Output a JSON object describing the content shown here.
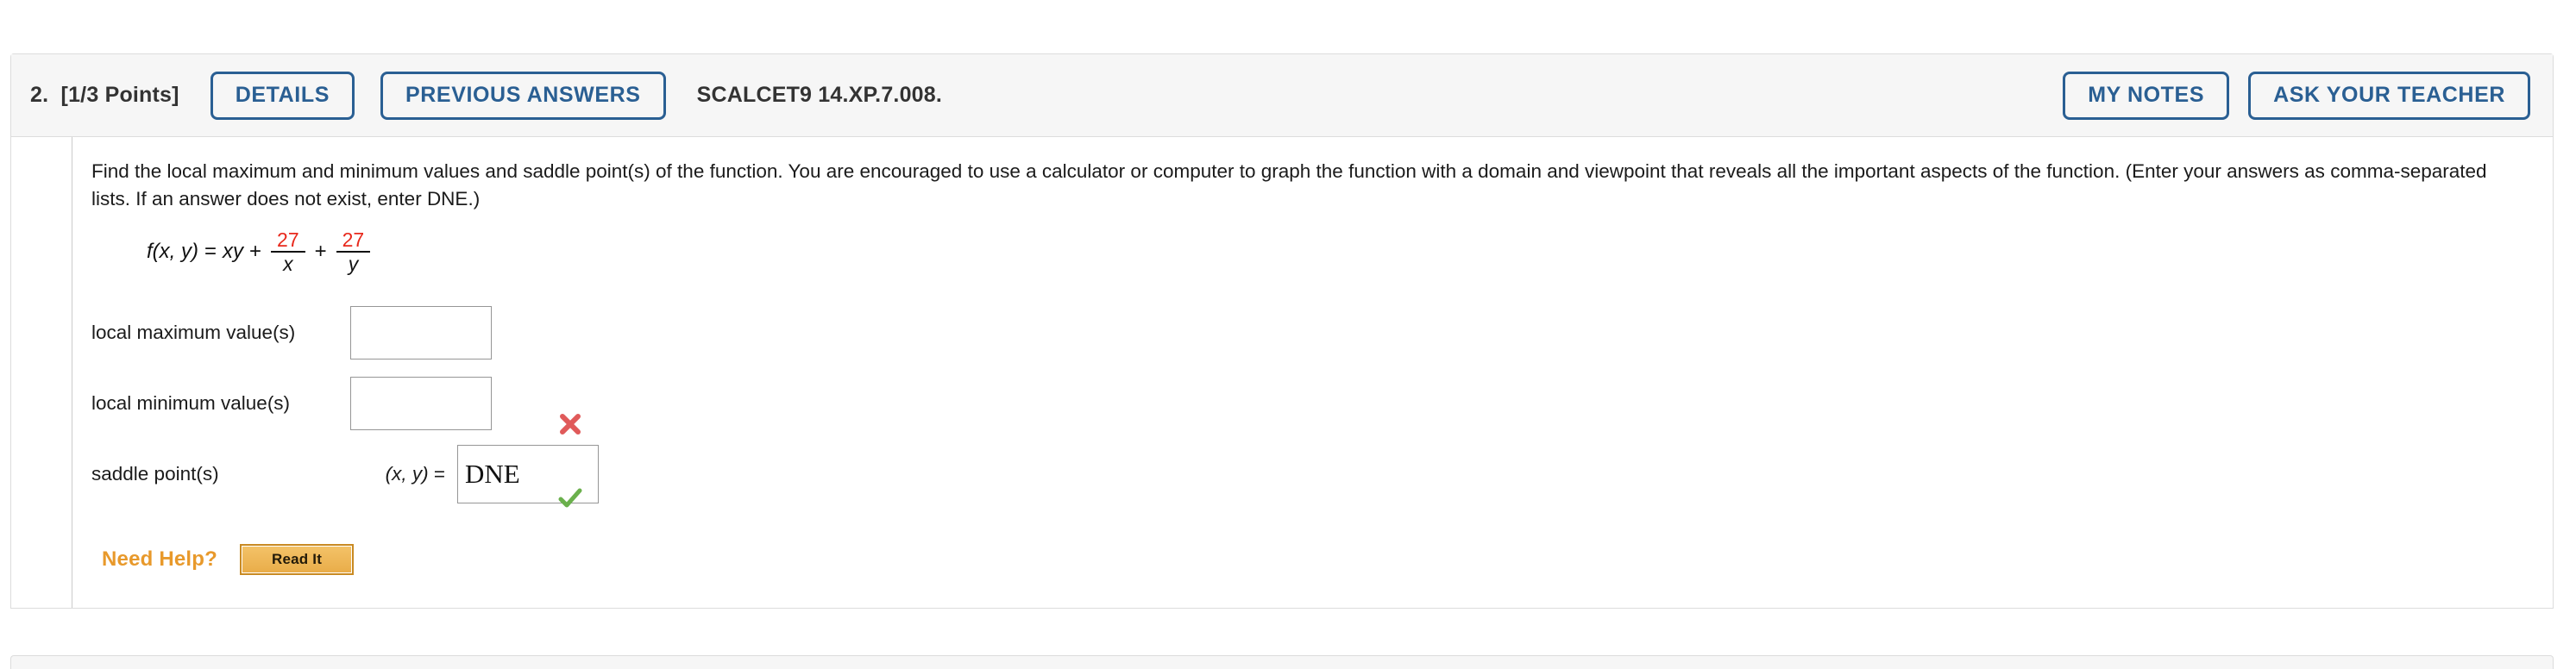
{
  "question": {
    "number_points": "2.  [1/3 Points]",
    "details_label": "DETAILS",
    "previous_answers_label": "PREVIOUS ANSWERS",
    "assignment_code": "SCALCET9 14.XP.7.008.",
    "my_notes_label": "MY NOTES",
    "ask_your_teacher_label": "ASK YOUR TEACHER"
  },
  "prompt": {
    "line1": "Find the local maximum and minimum values and saddle point(s) of the function. You are encouraged to use a calculator or computer to graph the function with a domain and viewpoint that reveals all the important aspects of the function. (Enter your answers as",
    "line2": "comma-separated lists. If an answer does not exist, enter DNE.)"
  },
  "formula": {
    "fname": "f",
    "args": "(x, y)",
    "equals": "=",
    "term1": "xy",
    "plus1": "+",
    "frac1_num": "27",
    "frac1_den": "x",
    "plus2": "+",
    "frac2_num": "27",
    "frac2_den": "y",
    "numerator_color": "#e8291c"
  },
  "answers": [
    {
      "label": "local maximum value(s)",
      "value": "",
      "mark": "none"
    },
    {
      "label": "local minimum value(s)",
      "value": "",
      "mark": "incorrect"
    },
    {
      "label": "saddle point(s)",
      "xy_prefix": "(x, y)",
      "xy_equals": "=",
      "value": "DNE",
      "mark": "correct"
    }
  ],
  "help": {
    "need_help_label": "Need Help?",
    "read_it_label": "Read It"
  },
  "colors": {
    "button_blue": "#2a5f93",
    "need_help_orange": "#e8992b",
    "read_it_gold": "#e9ad49",
    "correct_green": "#6ab04c",
    "incorrect_red": "#e05a5a",
    "header_gray": "#f6f6f6"
  }
}
